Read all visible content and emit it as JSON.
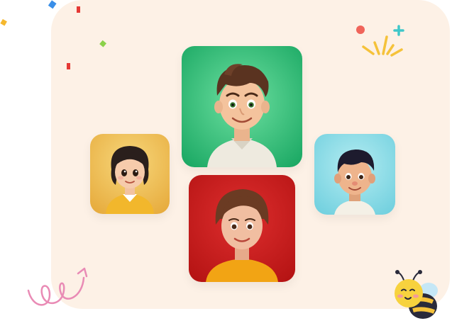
{
  "colors": {
    "panel": "#fdf1e6",
    "card_left_bg": "#f0c25a",
    "card_top_bg": "#2fbf7a",
    "card_right_bg": "#84dbe6",
    "card_bottom_bg": "#cc1d1d",
    "confetti_blue": "#3a8fe8",
    "confetti_red": "#e53935",
    "confetti_yellow": "#f5b82e",
    "confetti_green": "#8bd14a",
    "squiggle_pink": "#e98bb5",
    "burst_yellow": "#f5c23a",
    "burst_red": "#f0645a",
    "burst_teal": "#3fc7c9"
  },
  "cards": [
    {
      "id": "left",
      "subject": "girl-yellow-shirt",
      "icon": "avatar-girl"
    },
    {
      "id": "top",
      "subject": "boy-white-shirt",
      "icon": "avatar-boy"
    },
    {
      "id": "right",
      "subject": "boy-blue-background",
      "icon": "avatar-boy-small"
    },
    {
      "id": "bottom",
      "subject": "woman-yellow-top",
      "icon": "avatar-woman"
    }
  ],
  "decorations": [
    "confetti",
    "sparkle-burst",
    "pink-squiggle",
    "bee-mascot"
  ]
}
